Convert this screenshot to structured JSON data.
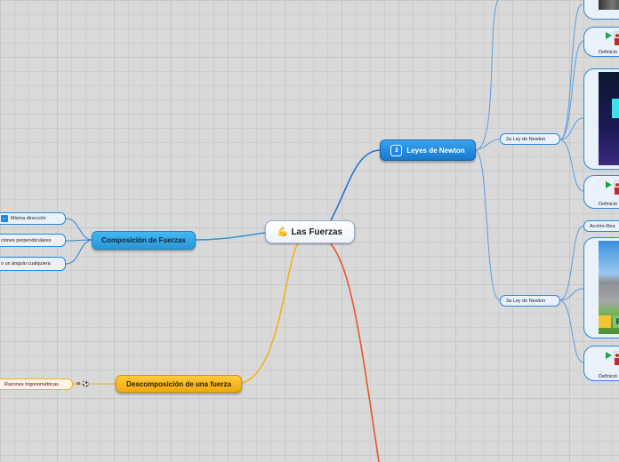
{
  "map": {
    "central": {
      "label": "Las Fuerzas",
      "icon": "flexed-biceps-icon"
    },
    "newton": {
      "label": "Leyes de Newton",
      "badge": "3",
      "second_law": "2a Ley de Newton",
      "third_law": "3a Ley de Newton",
      "action_reaction": "Acción-Rea",
      "definition": "Definició"
    },
    "composition": {
      "label": "Composición de Fuerzas",
      "items": [
        "Misma dirección",
        "ciones perpendiculares",
        "o un ángulo cualquiera"
      ]
    },
    "decomposition": {
      "label": "Descomposición de una fuerza",
      "child": "Razones trigonométricas",
      "note_icons": "≡ ⚽"
    }
  },
  "colors": {
    "background": "#d9d9d9",
    "blue_branch": "#1f77d0",
    "cyan_branch": "#2a96d6",
    "yellow_branch": "#f2b01e",
    "red_branch": "#e8552a"
  }
}
